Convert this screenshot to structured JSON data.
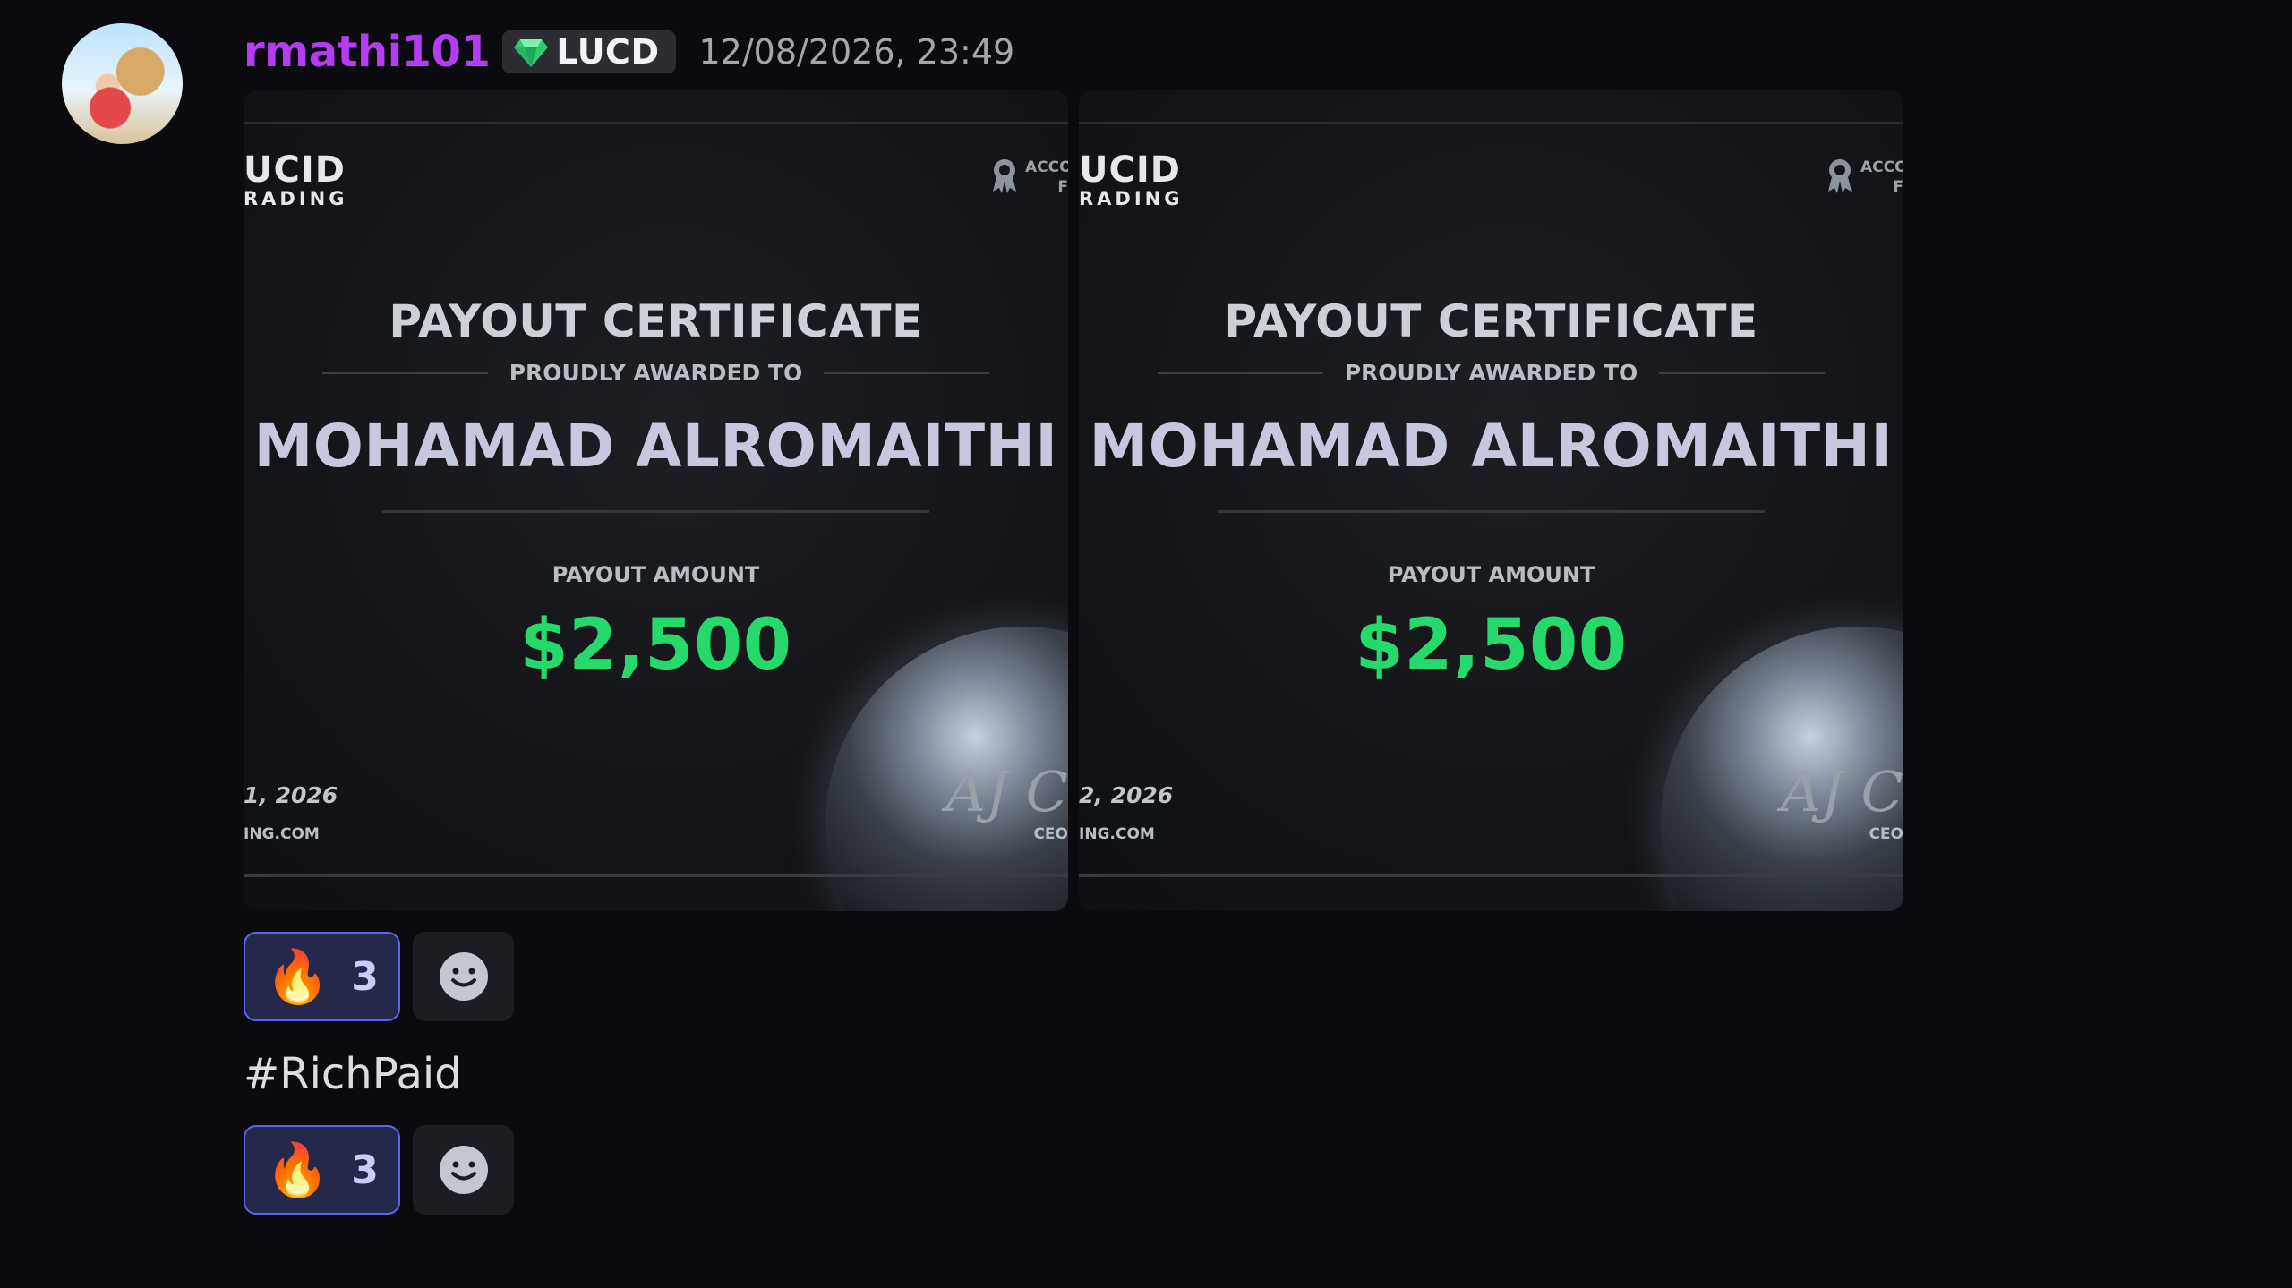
{
  "message": {
    "author": "rmathi101",
    "guild_tag": "LUCD",
    "timestamp": "12/08/2026, 23:49",
    "text": "#RichPaid"
  },
  "attachments": [
    {
      "brand_line1": "UCID",
      "brand_line2": "RADING",
      "badge_text_1": "ACCO",
      "badge_text_2": "F",
      "title": "PAYOUT CERTIFICATE",
      "awarded_to_label": "PROUDLY AWARDED TO",
      "recipient": "MOHAMAD ALROMAITHI",
      "payout_label": "PAYOUT AMOUNT",
      "payout_amount": "$2,500",
      "date_text": "1, 2026",
      "site_text": "ING.COM",
      "signature": "AJ C",
      "ceo_label": "CEO"
    },
    {
      "brand_line1": "UCID",
      "brand_line2": "RADING",
      "badge_text_1": "ACCO",
      "badge_text_2": "F",
      "title": "PAYOUT CERTIFICATE",
      "awarded_to_label": "PROUDLY AWARDED TO",
      "recipient": "MOHAMAD ALROMAITHI",
      "payout_label": "PAYOUT AMOUNT",
      "payout_amount": "$2,500",
      "date_text": "2, 2026",
      "site_text": "ING.COM",
      "signature": "AJ C",
      "ceo_label": "CEO"
    }
  ],
  "reactions": [
    {
      "emoji": "🔥",
      "count": "3"
    },
    {
      "emoji": "🔥",
      "count": "3"
    }
  ],
  "colors": {
    "username": "#b53cf5",
    "payout_amount": "#25d96a",
    "reaction_accent": "#5865f2"
  },
  "icons": {
    "guild_tag": "gem-icon",
    "add_reaction": "smiley-icon",
    "certificate_badge": "medal-icon"
  }
}
